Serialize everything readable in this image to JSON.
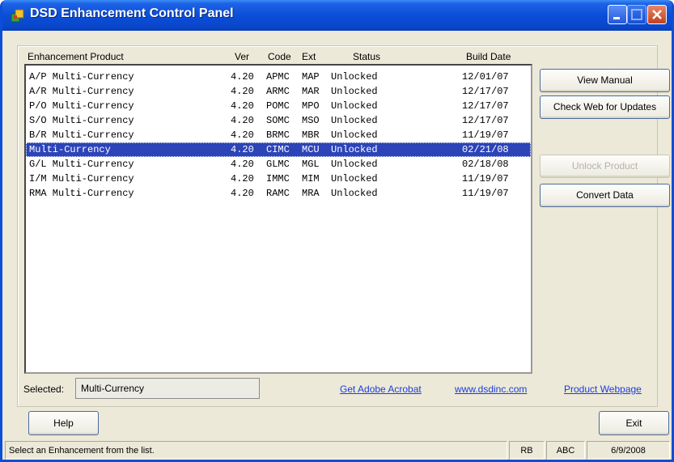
{
  "window": {
    "title": "DSD Enhancement Control Panel"
  },
  "list": {
    "headers": {
      "product": "Enhancement Product",
      "ver": "Ver",
      "code": "Code",
      "ext": "Ext",
      "status": "Status",
      "build": "Build Date"
    },
    "rows": [
      {
        "product": "A/P Multi-Currency",
        "ver": "4.20",
        "code": "APMC",
        "ext": "MAP",
        "status": "Unlocked",
        "build": "12/01/07"
      },
      {
        "product": "A/R Multi-Currency",
        "ver": "4.20",
        "code": "ARMC",
        "ext": "MAR",
        "status": "Unlocked",
        "build": "12/17/07"
      },
      {
        "product": "P/O Multi-Currency",
        "ver": "4.20",
        "code": "POMC",
        "ext": "MPO",
        "status": "Unlocked",
        "build": "12/17/07"
      },
      {
        "product": "S/O Multi-Currency",
        "ver": "4.20",
        "code": "SOMC",
        "ext": "MSO",
        "status": "Unlocked",
        "build": "12/17/07"
      },
      {
        "product": "B/R Multi-Currency",
        "ver": "4.20",
        "code": "BRMC",
        "ext": "MBR",
        "status": "Unlocked",
        "build": "11/19/07"
      },
      {
        "product": "Multi-Currency",
        "ver": "4.20",
        "code": "CIMC",
        "ext": "MCU",
        "status": "Unlocked",
        "build": "02/21/08"
      },
      {
        "product": "G/L Multi-Currency",
        "ver": "4.20",
        "code": "GLMC",
        "ext": "MGL",
        "status": "Unlocked",
        "build": "02/18/08"
      },
      {
        "product": "I/M Multi-Currency",
        "ver": "4.20",
        "code": "IMMC",
        "ext": "MIM",
        "status": "Unlocked",
        "build": "11/19/07"
      },
      {
        "product": "RMA Multi-Currency",
        "ver": "4.20",
        "code": "RAMC",
        "ext": "MRA",
        "status": "Unlocked",
        "build": "11/19/07"
      }
    ]
  },
  "buttons": {
    "view_manual": "View Manual",
    "check_web": "Check Web for Updates",
    "unlock": "Unlock Product",
    "convert": "Convert Data",
    "help": "Help",
    "exit": "Exit"
  },
  "selected": {
    "label": "Selected:",
    "value": "Multi-Currency"
  },
  "links": {
    "acrobat": "Get Adobe Acrobat",
    "website": "www.dsdinc.com",
    "webpage": "Product Webpage"
  },
  "statusbar": {
    "message": "Select an Enhancement from the list.",
    "user": "RB",
    "company": "ABC",
    "date": "6/9/2008"
  },
  "colors": {
    "selection": "#2c44b8",
    "titlebar": "#0b4ed8",
    "link": "#1b3ce0"
  },
  "icons": {
    "app": "app-icon",
    "minimize": "minimize-icon",
    "maximize": "maximize-icon",
    "close": "close-icon"
  }
}
